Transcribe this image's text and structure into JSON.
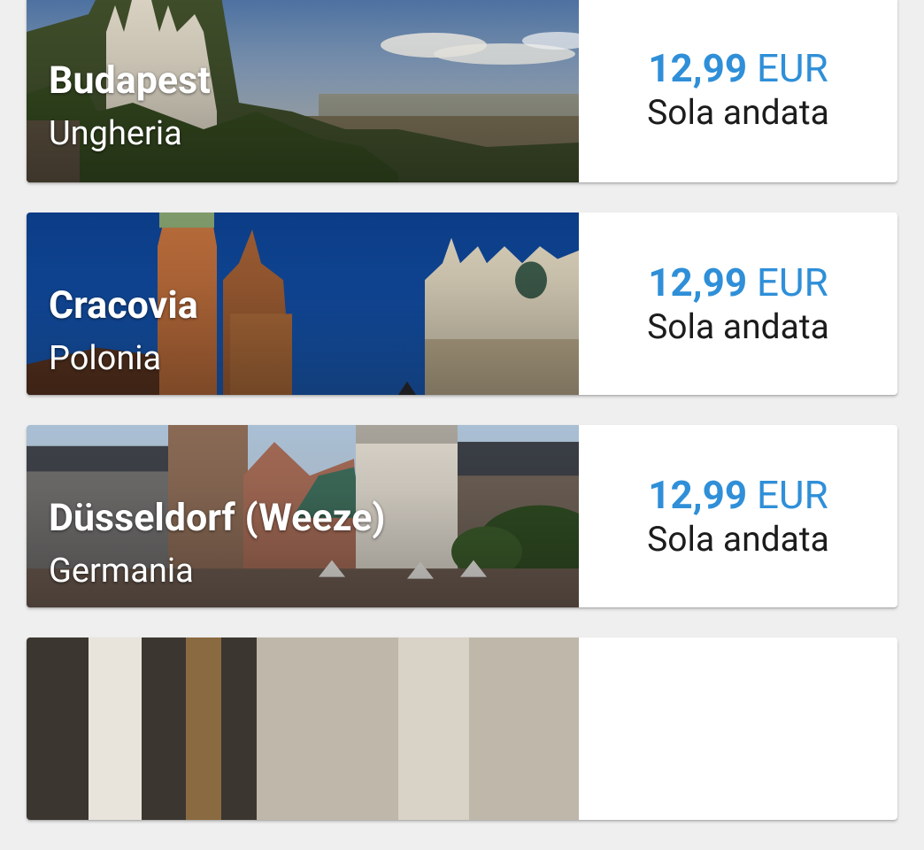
{
  "destinations": [
    {
      "city": "Budapest",
      "country": "Ungheria",
      "price_amount": "12,99",
      "currency": "EUR",
      "fare_type": "Sola andata"
    },
    {
      "city": "Cracovia",
      "country": "Polonia",
      "price_amount": "12,99",
      "currency": "EUR",
      "fare_type": "Sola andata"
    },
    {
      "city": "Düsseldorf (Weeze)",
      "country": "Germania",
      "price_amount": "12,99",
      "currency": "EUR",
      "fare_type": "Sola andata"
    }
  ],
  "colors": {
    "price": "#2f8fd8",
    "background": "#efefef",
    "card": "#ffffff"
  }
}
